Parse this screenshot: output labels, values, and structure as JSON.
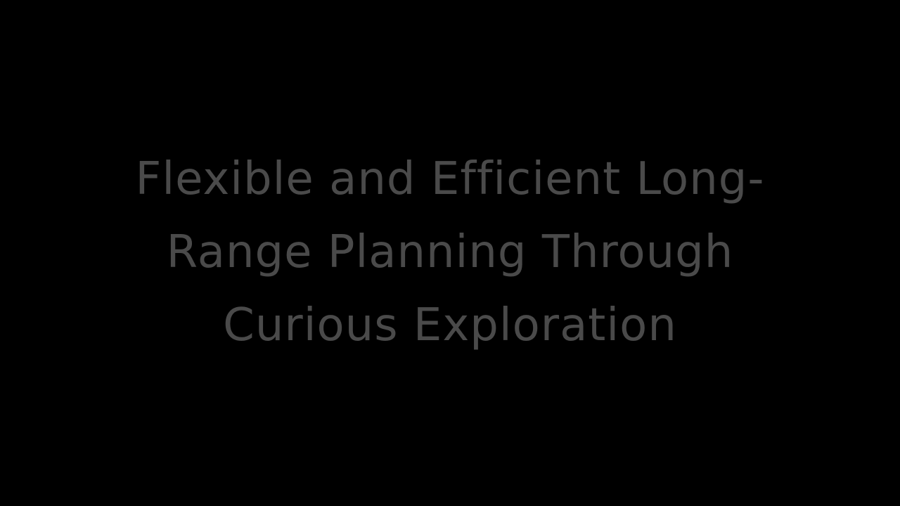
{
  "slide": {
    "background_color": "#000000",
    "text_color": "#4a4a4a",
    "title_lines": [
      "Flexible and Efficient Long-",
      "Range Planning Through",
      "Curious Exploration"
    ]
  }
}
